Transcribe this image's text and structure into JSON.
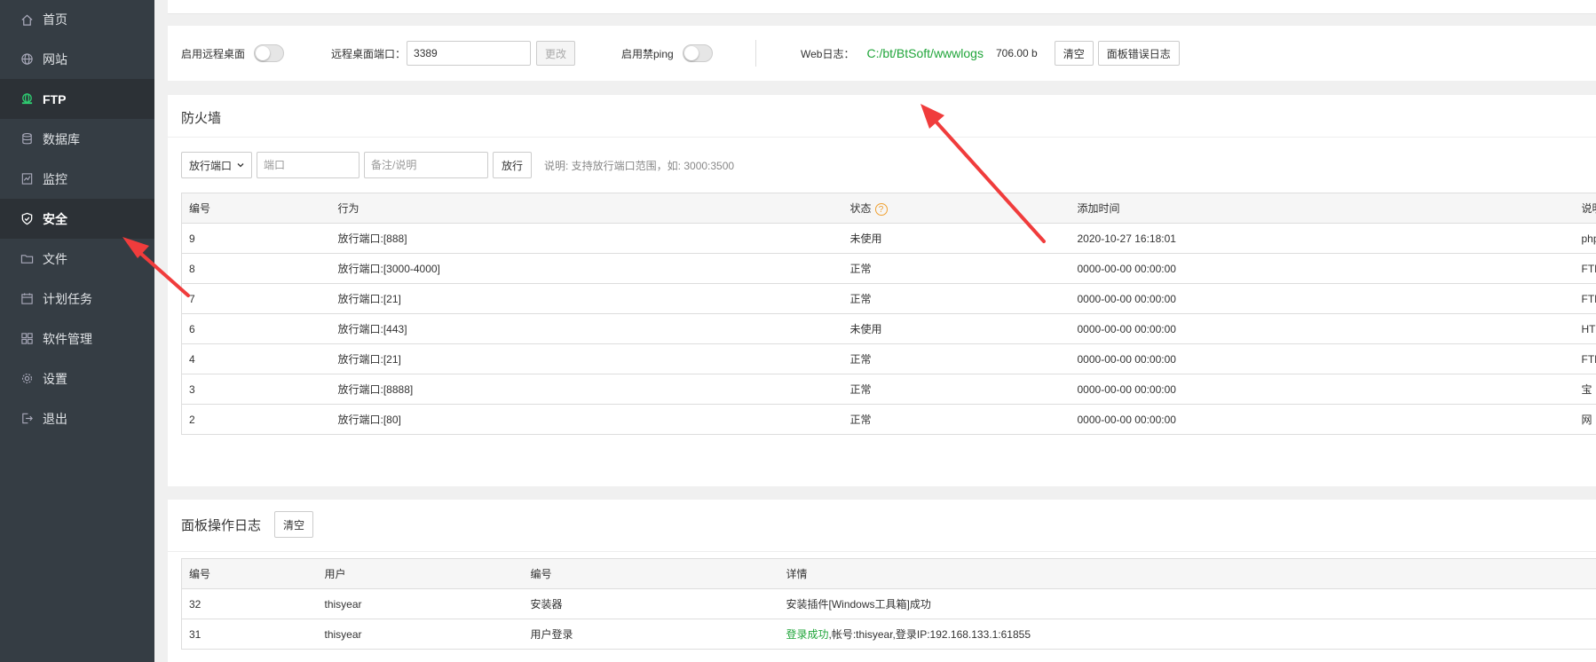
{
  "sidebar": {
    "items": [
      {
        "label": "首页",
        "icon": "home-icon"
      },
      {
        "label": "网站",
        "icon": "globe-icon"
      },
      {
        "label": "FTP",
        "icon": "ftp-icon"
      },
      {
        "label": "数据库",
        "icon": "database-icon"
      },
      {
        "label": "监控",
        "icon": "monitor-icon"
      },
      {
        "label": "安全",
        "icon": "shield-icon"
      },
      {
        "label": "文件",
        "icon": "folder-icon"
      },
      {
        "label": "计划任务",
        "icon": "calendar-icon"
      },
      {
        "label": "软件管理",
        "icon": "apps-icon"
      },
      {
        "label": "设置",
        "icon": "gear-icon"
      },
      {
        "label": "退出",
        "icon": "logout-icon"
      }
    ]
  },
  "options": {
    "remote_desktop_label": "启用远程桌面",
    "remote_port_label": "远程桌面端口：",
    "remote_port_value": "3389",
    "change_label": "更改",
    "ping_label": "启用禁ping",
    "weblog_label": "Web日志：",
    "weblog_path": "C:/bt/BtSoft/wwwlogs",
    "weblog_size": "706.00 b",
    "clear_label": "清空",
    "panel_error_log_label": "面板错误日志"
  },
  "firewall": {
    "title": "防火墙",
    "select_value": "放行端口",
    "port_placeholder": "端口",
    "note_placeholder": "备注/说明",
    "allow_label": "放行",
    "hint": "说明: 支持放行端口范围，如: 3000:3500",
    "columns": [
      "编号",
      "行为",
      "状态",
      "添加时间",
      "说明"
    ],
    "rows": [
      {
        "id": "9",
        "action": "放行端口:[888]",
        "status": "未使用",
        "time": "2020-10-27 16:18:01",
        "note": "php"
      },
      {
        "id": "8",
        "action": "放行端口:[3000-4000]",
        "status": "正常",
        "time": "0000-00-00 00:00:00",
        "note": "FTP"
      },
      {
        "id": "7",
        "action": "放行端口:[21]",
        "status": "正常",
        "time": "0000-00-00 00:00:00",
        "note": "FTP"
      },
      {
        "id": "6",
        "action": "放行端口:[443]",
        "status": "未使用",
        "time": "0000-00-00 00:00:00",
        "note": "HT"
      },
      {
        "id": "4",
        "action": "放行端口:[21]",
        "status": "正常",
        "time": "0000-00-00 00:00:00",
        "note": "FTP"
      },
      {
        "id": "3",
        "action": "放行端口:[8888]",
        "status": "正常",
        "time": "0000-00-00 00:00:00",
        "note": "宝"
      },
      {
        "id": "2",
        "action": "放行端口:[80]",
        "status": "正常",
        "time": "0000-00-00 00:00:00",
        "note": "网"
      }
    ]
  },
  "oplog": {
    "title": "面板操作日志",
    "clear_label": "清空",
    "columns": [
      "编号",
      "用户",
      "编号",
      "详情"
    ],
    "rows": [
      {
        "id": "32",
        "user": "thisyear",
        "type": "安装器",
        "detail_prefix": "",
        "detail": "安装插件[Windows工具箱]成功"
      },
      {
        "id": "31",
        "user": "thisyear",
        "type": "用户登录",
        "detail_prefix": "登录成功",
        "detail": ",帐号:thisyear,登录IP:192.168.133.1:61855"
      }
    ]
  },
  "colors": {
    "sidebar_bg": "#353d44",
    "accent_green": "#20a53a",
    "arrow_red": "#f03c3c"
  }
}
